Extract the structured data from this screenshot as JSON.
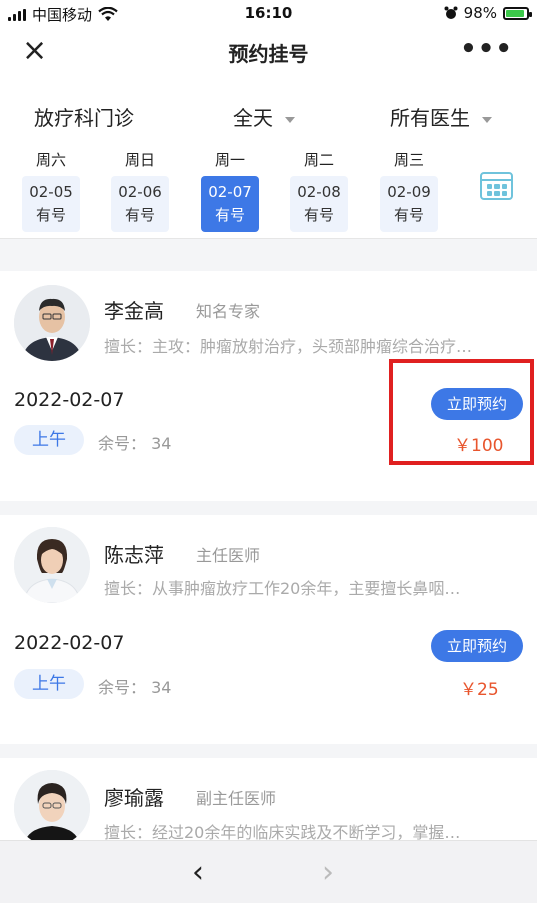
{
  "status_bar": {
    "carrier": "中国移动",
    "time": "16:10",
    "battery": "98%",
    "wifi_icon": "wifi-icon",
    "alarm_icon": "alarm-clock-icon"
  },
  "nav": {
    "close_icon": "×",
    "title": "预约挂号",
    "more_icon": "•••"
  },
  "filters": {
    "department": "放疗科门诊",
    "time_range": "全天",
    "doctor": "所有医生"
  },
  "dates": [
    {
      "weekday": "周六",
      "date": "02-05",
      "status": "有号",
      "selected": false
    },
    {
      "weekday": "周日",
      "date": "02-06",
      "status": "有号",
      "selected": false
    },
    {
      "weekday": "周一",
      "date": "02-07",
      "status": "有号",
      "selected": true
    },
    {
      "weekday": "周二",
      "date": "02-08",
      "status": "有号",
      "selected": false
    },
    {
      "weekday": "周三",
      "date": "02-09",
      "status": "有号",
      "selected": false
    }
  ],
  "doctors": [
    {
      "name": "李金高",
      "title": "知名专家",
      "skill": "擅长：主攻：肿瘤放射治疗，头颈部肿瘤综合治疗…",
      "date": "2022-02-07",
      "book_label": "立即预约",
      "period": "上午",
      "remain_label": "余号：",
      "remain_count": "34",
      "price": "￥100"
    },
    {
      "name": "陈志萍",
      "title": "主任医师",
      "skill": "擅长：从事肿瘤放疗工作20余年，主要擅长鼻咽…",
      "date": "2022-02-07",
      "book_label": "立即预约",
      "period": "上午",
      "remain_label": "余号：",
      "remain_count": "34",
      "price": "￥25"
    },
    {
      "name": "廖瑜露",
      "title": "副主任医师",
      "skill": "擅长：经过20余年的临床实践及不断学习，掌握…"
    }
  ],
  "toolbar": {
    "back_icon": "‹",
    "forward_icon": "›"
  },
  "colors": {
    "accent": "#3d78e6",
    "price": "#e8552d",
    "highlight_box": "#e02020"
  }
}
